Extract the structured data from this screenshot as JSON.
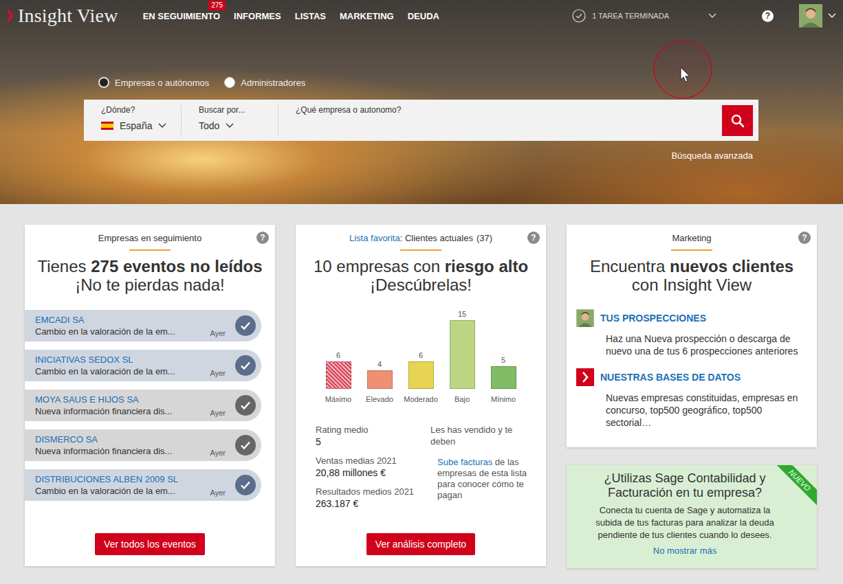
{
  "topbar": {
    "logo": "Insight View",
    "nav": [
      {
        "label": "EN SEGUIMIENTO",
        "badge": "275"
      },
      {
        "label": "INFORMES"
      },
      {
        "label": "LISTAS"
      },
      {
        "label": "MARKETING"
      },
      {
        "label": "DEUDA"
      }
    ],
    "tasks": "1 TAREA TERMINADA",
    "help": "?"
  },
  "search": {
    "modes": [
      {
        "label": "Empresas o autónomos",
        "selected": true
      },
      {
        "label": "Administradores",
        "selected": false
      }
    ],
    "fields": [
      {
        "kind": "country",
        "label": "¿Dónde?",
        "value": "España"
      },
      {
        "kind": "select",
        "label": "Buscar por...",
        "value": "Todo"
      }
    ],
    "query": {
      "label": "¿Qué empresa o autonomo?",
      "value": ""
    },
    "advanced": "Búsqueda avanzada"
  },
  "watch_card": {
    "header": "Empresas en seguimiento",
    "help": "?",
    "title": [
      {
        "text": "Tienes ",
        "bold": false
      },
      {
        "text": "275 eventos no leídos",
        "bold": true
      }
    ],
    "subtitle": "¡No te pierdas nada!",
    "events": [
      {
        "company": "EMCADI SA",
        "description": "Cambio en la valoración de la em...",
        "time": "Ayer",
        "unread": true
      },
      {
        "company": "INICIATIVAS SEDOX SL",
        "description": "Cambio en la valoración de la em...",
        "time": "Ayer",
        "unread": true
      },
      {
        "company": "MOYA SAUS E HIJOS SA",
        "description": "Nueva información financiera dis...",
        "time": "Ayer",
        "unread": false
      },
      {
        "company": "DISMERCO SA",
        "description": "Nueva información financiera dis...",
        "time": "Ayer",
        "unread": false
      },
      {
        "company": "DISTRIBUCIONES ALBEN 2009 SL",
        "description": "Cambio en la valoración de la em...",
        "time": "Ayer",
        "unread": true
      }
    ],
    "button": "Ver todos los eventos"
  },
  "list_card": {
    "header_link": "Lista favorita",
    "header_text": ": Clientes actuales",
    "header_count": "(37)",
    "help": "?",
    "title": [
      {
        "text": "10 empresas con ",
        "bold": false
      },
      {
        "text": "riesgo alto",
        "bold": true
      }
    ],
    "subtitle": "¡Descúbrelas!",
    "chart": {
      "bars": [
        {
          "label": "Máximo",
          "value": 6,
          "reading": "6",
          "color": "#d9475a",
          "hatched": true
        },
        {
          "label": "Elevado",
          "value": 4,
          "reading": "4",
          "color": "#ef8f73",
          "hatched": false
        },
        {
          "label": "Moderado",
          "value": 6,
          "reading": "6",
          "color": "#e6d452",
          "hatched": false
        },
        {
          "label": "Bajo",
          "value": 15,
          "reading": "15",
          "color": "#bcd684",
          "hatched": false
        },
        {
          "label": "Mínimo",
          "value": 5,
          "reading": "5",
          "color": "#80bb66",
          "hatched": false
        }
      ]
    },
    "stats": [
      {
        "label": "Rating medio",
        "value": "5"
      },
      {
        "label": "Ventas medias 2021",
        "value": "20,88 millones €"
      },
      {
        "label": "Resultados medios 2021",
        "value": "263.187 €"
      }
    ],
    "debt": {
      "text": "Les has vendido y te deben",
      "link": "Sube facturas",
      "link_suffix": " de las empresas de esta lista para conocer cómo te pagan"
    },
    "button": "Ver análisis completo"
  },
  "marketing_card": {
    "header": "Marketing",
    "help": "?",
    "title": [
      {
        "text": "Encuentra ",
        "bold": false
      },
      {
        "text": "nuevos clientes",
        "bold": true
      }
    ],
    "subtitle": "con Insight View",
    "items": [
      {
        "kind": "avatar",
        "title": "TUS PROSPECCIONES",
        "text": "Haz una Nueva prospección o descarga de nuevo una de tus 6 prospecciones anteriores"
      },
      {
        "kind": "database",
        "title": "NUESTRAS BASES DE DATOS",
        "text": "Nuevas empresas constituidas, empresas en concurso, top500 geográfico, top500 sectorial…"
      }
    ]
  },
  "promo_card": {
    "ribbon": "NUEVO",
    "title": "¿Utilizas Sage Contabilidad y Facturación en tu empresa?",
    "text": "Conecta tu cuenta de Sage y automatiza la subida de tus facturas para analizar la deuda pendiente de tus clientes cuando lo desees.",
    "link": "No mostrar más"
  }
}
